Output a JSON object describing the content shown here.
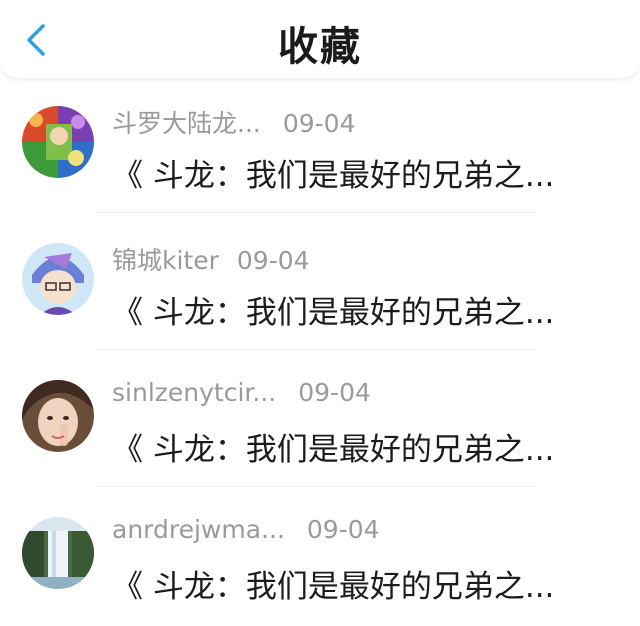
{
  "header": {
    "title": "收藏",
    "back_icon": "chevron-left-icon",
    "accent_color": "#2f9fe8"
  },
  "items": [
    {
      "author": "斗罗大陆龙...",
      "date": "09-04",
      "title": "《 斗龙：我们是最好的兄弟之...",
      "avatar": "anime-collage-avatar"
    },
    {
      "author": "锦城kiter",
      "date": "09-04",
      "title": "《 斗龙：我们是最好的兄弟之...",
      "avatar": "anime-character-avatar"
    },
    {
      "author": "sinlzenytcir...",
      "date": "09-04",
      "title": "《 斗龙：我们是最好的兄弟之...",
      "avatar": "portrait-photo-avatar"
    },
    {
      "author": "anrdrejwma...",
      "date": "09-04",
      "title": "《 斗龙：我们是最好的兄弟之...",
      "avatar": "waterfall-photo-avatar"
    }
  ]
}
